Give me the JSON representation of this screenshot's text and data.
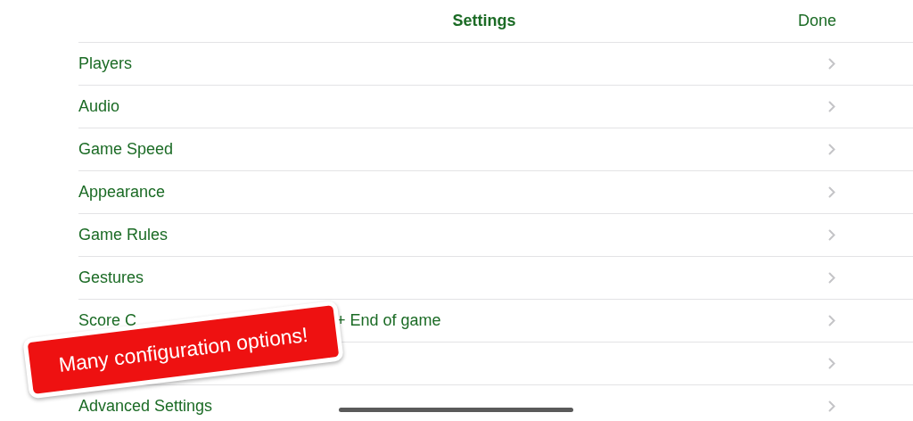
{
  "header": {
    "title": "Settings",
    "done": "Done"
  },
  "rows": [
    {
      "label": "Players"
    },
    {
      "label": "Audio"
    },
    {
      "label": "Game Speed"
    },
    {
      "label": "Appearance"
    },
    {
      "label": "Game Rules"
    },
    {
      "label": "Gestures"
    },
    {
      "label": "Score C",
      "label_after": "+ End of game"
    },
    {},
    {
      "label": "Advanced Settings"
    }
  ],
  "banner": "Many configuration options!"
}
